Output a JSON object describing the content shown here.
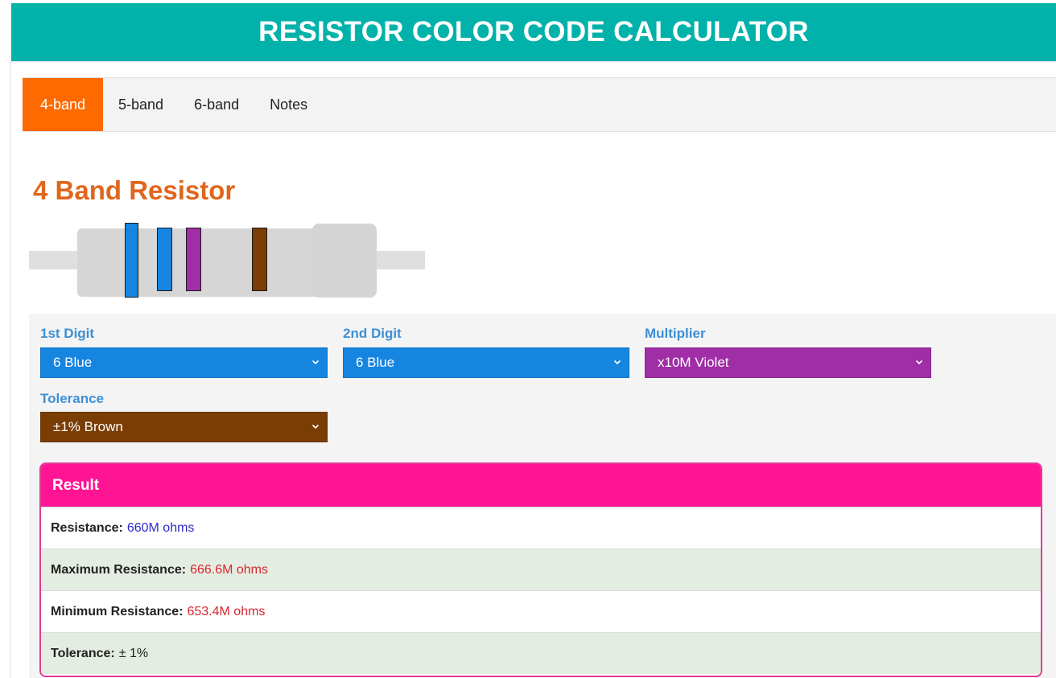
{
  "header": {
    "title": "RESISTOR COLOR CODE CALCULATOR"
  },
  "tabs": [
    {
      "label": "4-band",
      "active": true
    },
    {
      "label": "5-band",
      "active": false
    },
    {
      "label": "6-band",
      "active": false
    },
    {
      "label": "Notes",
      "active": false
    }
  ],
  "section": {
    "title": "4 Band Resistor"
  },
  "resistor": {
    "bands": [
      "#1585e0",
      "#1585e0",
      "#a02ea6",
      "#7a3e05"
    ]
  },
  "fields": {
    "first_digit": {
      "label": "1st Digit",
      "value": "6 Blue",
      "color": "#1585e0"
    },
    "second_digit": {
      "label": "2nd Digit",
      "value": "6 Blue",
      "color": "#1585e0"
    },
    "multiplier": {
      "label": "Multiplier",
      "value": "x10M Violet",
      "color": "#a02ea6"
    },
    "tolerance": {
      "label": "Tolerance",
      "value": "±1% Brown",
      "color": "#7a3e05"
    }
  },
  "result": {
    "title": "Result",
    "resistance": {
      "label": "Resistance:",
      "value": "660M ohms"
    },
    "max_resistance": {
      "label": "Maximum Resistance:",
      "value": "666.6M ohms"
    },
    "min_resistance": {
      "label": "Minimum Resistance:",
      "value": "653.4M ohms"
    },
    "tolerance": {
      "label": "Tolerance:",
      "value": "± 1%"
    }
  },
  "colors": {
    "header_bg": "#00b2a9",
    "active_tab": "#ff6a00",
    "title": "#e0661c",
    "result_header": "#ff1493"
  }
}
